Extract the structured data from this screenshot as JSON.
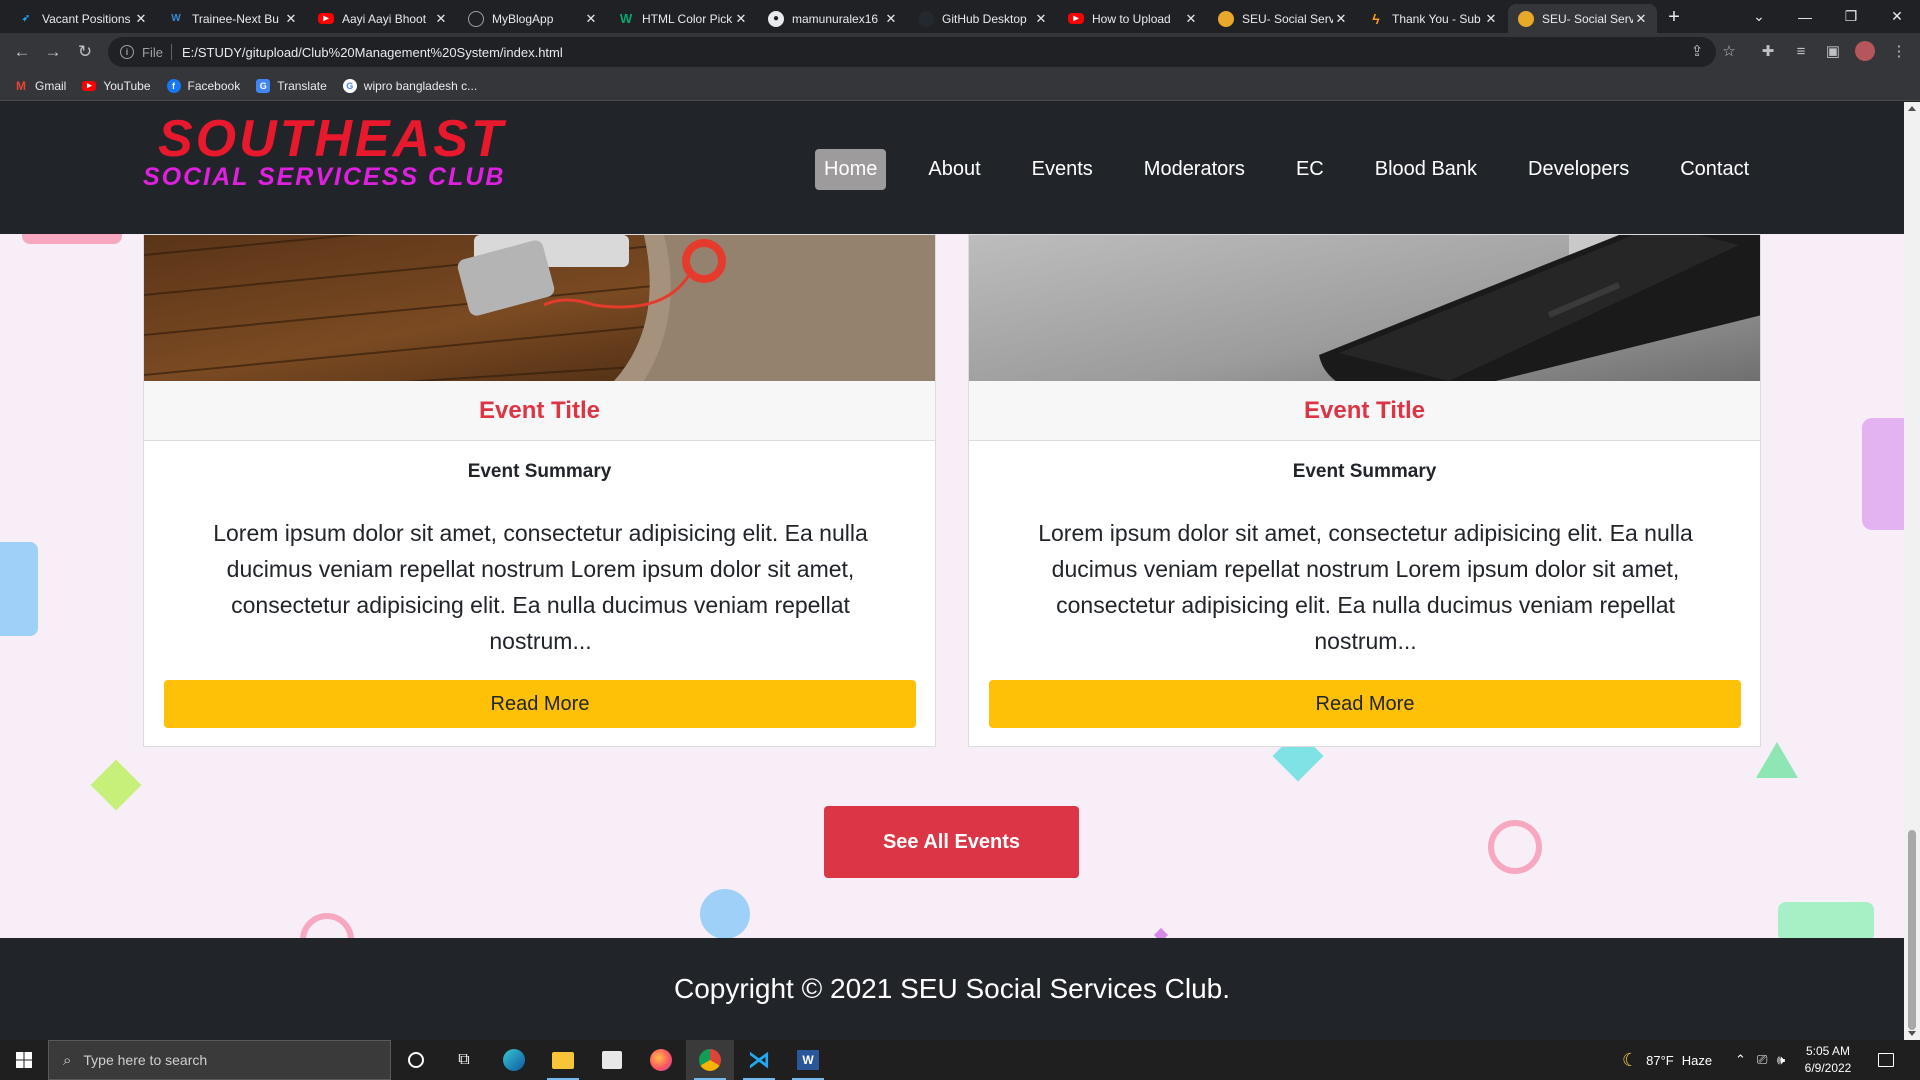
{
  "browser": {
    "tabs": [
      {
        "title": "Vacant Positions",
        "favicon": "feather-icon",
        "color": "#1da1f2"
      },
      {
        "title": "Trainee-Next Bu",
        "favicon": "wordpress-icon",
        "color": "#3b8ad8"
      },
      {
        "title": "Aayi Aayi Bhoot",
        "favicon": "youtube-icon",
        "color": "#ff0000"
      },
      {
        "title": "MyBlogApp",
        "favicon": "globe-icon",
        "color": "#9aa0a6"
      },
      {
        "title": "HTML Color Pick",
        "favicon": "w3-icon",
        "color": "#04aa6d"
      },
      {
        "title": "mamunuralex16",
        "favicon": "github-icon",
        "color": "#e8eaed"
      },
      {
        "title": "GitHub Desktop",
        "favicon": "github-desktop-icon",
        "color": "#24292f"
      },
      {
        "title": "How to Upload",
        "favicon": "youtube-icon",
        "color": "#ff0000"
      },
      {
        "title": "SEU- Social Serv",
        "favicon": "club-icon",
        "color": "#e8a92b"
      },
      {
        "title": "Thank You - Sub",
        "favicon": "lightning-icon",
        "color": "#f6a21c"
      },
      {
        "title": "SEU- Social Serv",
        "favicon": "club-icon",
        "color": "#e8a92b",
        "active": true
      }
    ],
    "new_tab": "+",
    "address": {
      "scheme": "File",
      "url": "E:/STUDY/gitupload/Club%20Management%20System/index.html"
    },
    "bookmarks": [
      {
        "label": "Gmail",
        "icon": "gmail-icon",
        "color": "#ea4335"
      },
      {
        "label": "YouTube",
        "icon": "youtube-icon",
        "color": "#ff0000"
      },
      {
        "label": "Facebook",
        "icon": "facebook-icon",
        "color": "#1877f2"
      },
      {
        "label": "Translate",
        "icon": "translate-icon",
        "color": "#4285f4"
      },
      {
        "label": "wipro bangladesh c...",
        "icon": "google-icon",
        "color": "#ffffff"
      }
    ]
  },
  "site": {
    "logo": {
      "main": "SOUTHEAST",
      "sub": "SOCIAL SERVICESS CLUB"
    },
    "nav": [
      "Home",
      "About",
      "Events",
      "Moderators",
      "EC",
      "Blood Bank",
      "Developers",
      "Contact"
    ],
    "active_nav": "Home",
    "events": [
      {
        "title": "Event Title",
        "summary_heading": "Event Summary",
        "body": "Lorem ipsum dolor sit amet, consectetur adipisicing elit. Ea nulla ducimus veniam repellat nostrum Lorem ipsum dolor sit amet, consectetur adipisicing elit. Ea nulla ducimus veniam repellat nostrum...",
        "button": "Read More"
      },
      {
        "title": "Event Title",
        "summary_heading": "Event Summary",
        "body": "Lorem ipsum dolor sit amet, consectetur adipisicing elit. Ea nulla ducimus veniam repellat nostrum Lorem ipsum dolor sit amet, consectetur adipisicing elit. Ea nulla ducimus veniam repellat nostrum...",
        "button": "Read More"
      }
    ],
    "see_all": "See All Events",
    "footer": "Copyright © 2021 SEU Social Services Club."
  },
  "taskbar": {
    "search_placeholder": "Type here to search",
    "weather": {
      "temp": "87°F",
      "condition": "Haze"
    },
    "time": "5:05 AM",
    "date": "6/9/2022"
  },
  "colors": {
    "accent_red": "#dc3545",
    "button_yellow": "#ffc107",
    "logo_red": "#e8182d",
    "logo_magenta": "#e020e0",
    "header_bg": "#212529",
    "page_bg": "#f7eef7"
  }
}
